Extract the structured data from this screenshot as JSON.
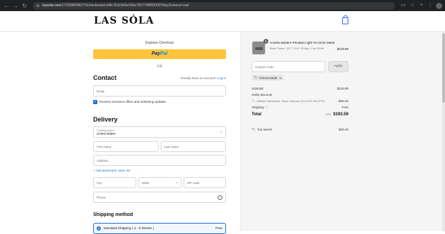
{
  "browser": {
    "url_domain": "lassola.com",
    "url_path": "/17335854961?3/checkouts/cn/Ac7b3c0e6a7b0e760774ff0f0000?/buyScience=cart"
  },
  "store": {
    "logo": "LAS SÓLA"
  },
  "express": {
    "label": "Express Checkout",
    "paypal_a": "Pay",
    "paypal_b": "Pal",
    "or": "OR"
  },
  "contact": {
    "heading": "Contact",
    "login_prompt": "Already have an account?",
    "login_link": "Log in",
    "email_placeholder": "Email",
    "offers_label": "Receive exclusive offers and marketing updates"
  },
  "delivery": {
    "heading": "Delivery",
    "country_label": "Country/region",
    "country_value": "United States",
    "first_name": "First name",
    "last_name": "Last name",
    "address": "Address",
    "add_apartment": "+ Add apartment, suite, etc.",
    "city": "City",
    "state": "State",
    "zip": "ZIP code",
    "phone": "Phone"
  },
  "shipping": {
    "heading": "Shipping method",
    "option": "Standard Shipping ( 4 - 6 Weeks )",
    "price": "Free"
  },
  "summary": {
    "product_name": "Arosha Modern Pendant Light Tri-Circle Metal",
    "product_variant": "Black Frame / 15.7\" 23.6\" 3Rings / Cool White",
    "product_qty": "1",
    "product_price": "$219.99",
    "coupon_placeholder": "Coupon code",
    "apply_label": "Apply",
    "applied_code": "TARAKHOME",
    "subtotal_label": "Subtotal",
    "subtotal_value": "$219.99",
    "order_discount_label": "Order discount",
    "discount_name": "Affiliate Distribution, Basic discount (DO NOT DELETE)",
    "discount_value": "-$26.40",
    "shipping_label": "Shipping",
    "shipping_value": "Free",
    "total_label": "Total",
    "total_currency": "USD",
    "total_value": "$193.59",
    "saved_label": "You saved",
    "saved_value": "-$26.40"
  },
  "colors": {
    "accent": "#1a6ed8",
    "paypal": "#ffc439",
    "sidebar_bg": "#f5f5f5"
  }
}
